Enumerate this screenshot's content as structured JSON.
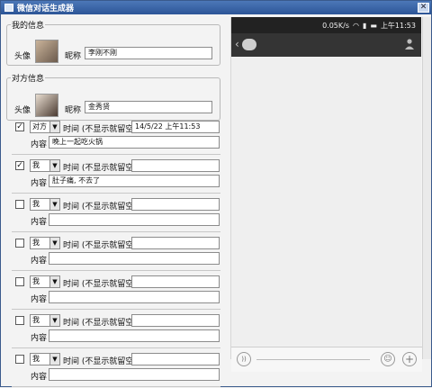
{
  "window": {
    "title": "微信对话生成器"
  },
  "my_info": {
    "legend": "我的信息",
    "avatar_label": "头像",
    "nickname_label": "昵称",
    "nickname_value": "李刚不刚"
  },
  "peer_info": {
    "legend": "对方信息",
    "avatar_label": "头像",
    "nickname_label": "昵称",
    "nickname_value": "金秀贤"
  },
  "messages": [
    {
      "checked": true,
      "checkmark": "✓",
      "sender": "对方",
      "time_label": "时间 (不显示就留空)",
      "time_value": "14/5/22 上午11:53",
      "content_label": "内容",
      "content_value": "晚上一起吃火锅"
    },
    {
      "checked": true,
      "checkmark": "✓",
      "sender": "我",
      "time_label": "时间 (不显示就留空)",
      "time_value": "",
      "content_label": "内容",
      "content_value": "肚子痛, 不去了"
    },
    {
      "checked": false,
      "checkmark": "",
      "sender": "我",
      "time_label": "时间 (不显示就留空)",
      "time_value": "",
      "content_label": "内容",
      "content_value": ""
    },
    {
      "checked": false,
      "checkmark": "",
      "sender": "我",
      "time_label": "时间 (不显示就留空)",
      "time_value": "",
      "content_label": "内容",
      "content_value": ""
    },
    {
      "checked": false,
      "checkmark": "",
      "sender": "我",
      "time_label": "时间 (不显示就留空)",
      "time_value": "",
      "content_label": "内容",
      "content_value": ""
    },
    {
      "checked": false,
      "checkmark": "",
      "sender": "我",
      "time_label": "时间 (不显示就留空)",
      "time_value": "",
      "content_label": "内容",
      "content_value": ""
    },
    {
      "checked": false,
      "checkmark": "",
      "sender": "我",
      "time_label": "时间 (不显示就留空)",
      "time_value": "",
      "content_label": "内容",
      "content_value": ""
    }
  ],
  "phone": {
    "status_speed": "0.05K/s",
    "status_time": "上午11:53",
    "icons": {
      "back": "back-icon",
      "logo": "wechat-icon",
      "profile": "person-icon",
      "voice": "voice-icon",
      "emoji": "emoji-icon",
      "plus": "plus-icon"
    },
    "colors": {
      "status_bg": "#222222",
      "nav_bg": "#343434",
      "chat_bg": "#efefef"
    }
  }
}
